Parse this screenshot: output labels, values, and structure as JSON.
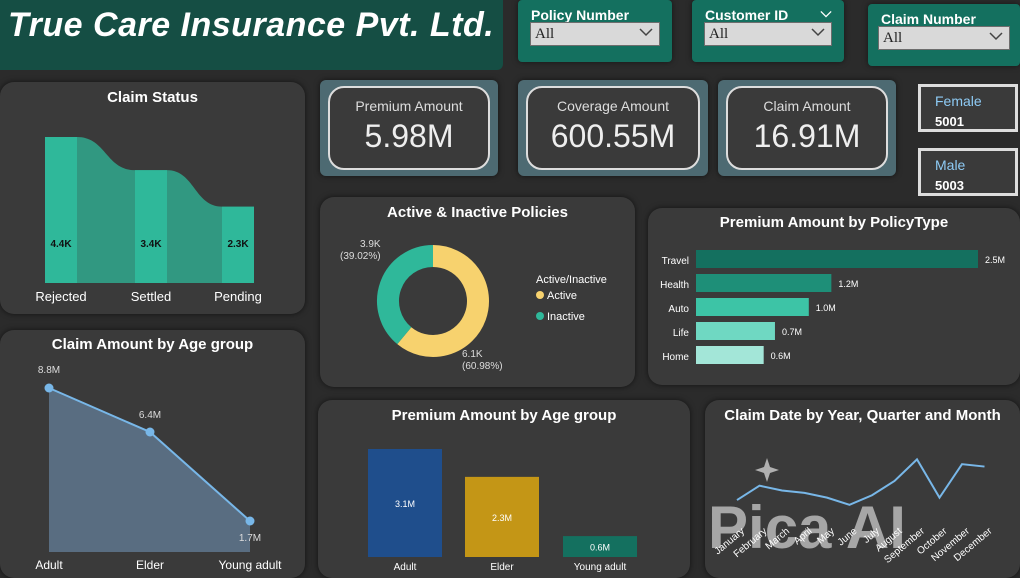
{
  "header": {
    "title": "True Care Insurance Pvt. Ltd."
  },
  "slicers": [
    {
      "label": "Policy Number",
      "value": "All"
    },
    {
      "label": "Customer ID",
      "value": "All"
    },
    {
      "label": "Claim Number",
      "value": "All"
    }
  ],
  "kpis": [
    {
      "label": "Premium Amount",
      "value": "5.98M"
    },
    {
      "label": "Coverage Amount",
      "value": "600.55M"
    },
    {
      "label": "Claim Amount",
      "value": "16.91M"
    }
  ],
  "gender": [
    {
      "label": "Female",
      "value": "5001"
    },
    {
      "label": "Male",
      "value": "5003"
    }
  ],
  "watermark": "Pica AI",
  "colors": {
    "teal": "#2fb89a",
    "dark_teal": "#14705f",
    "yellow": "#f7d26e",
    "blue_line": "#78b7e8",
    "bar_blue": "#1f4e8c",
    "bar_gold": "#c49616"
  },
  "chart_data": [
    {
      "type": "area",
      "title": "Claim Status",
      "categories": [
        "Rejected",
        "Settled",
        "Pending"
      ],
      "values": [
        4400,
        3400,
        2300
      ],
      "data_labels": [
        "4.4K",
        "3.4K",
        "2.3K"
      ]
    },
    {
      "type": "pie",
      "title": "Active & Inactive Policies",
      "legend_title": "Active/Inactive",
      "legend_position": "right",
      "categories": [
        "Active",
        "Inactive"
      ],
      "values": [
        6100,
        3900
      ],
      "data_labels": [
        "6.1K\n(60.98%)",
        "3.9K\n(39.02%)"
      ],
      "percent_labels": [
        "(60.98%)",
        "(39.02%)"
      ],
      "value_labels": [
        "6.1K",
        "3.9K"
      ]
    },
    {
      "type": "bar",
      "orientation": "horizontal",
      "title": "Premium Amount by PolicyType",
      "categories": [
        "Travel",
        "Health",
        "Auto",
        "Life",
        "Home"
      ],
      "values": [
        2.5,
        1.2,
        1.0,
        0.7,
        0.6
      ],
      "data_labels": [
        "2.5M",
        "1.2M",
        "1.0M",
        "0.7M",
        "0.6M"
      ]
    },
    {
      "type": "area",
      "title": "Claim Amount by Age group",
      "categories": [
        "Adult",
        "Elder",
        "Young adult"
      ],
      "values": [
        8.8,
        6.4,
        1.7
      ],
      "data_labels": [
        "8.8M",
        "6.4M",
        "1.7M"
      ]
    },
    {
      "type": "bar",
      "title": "Premium Amount by Age group",
      "categories": [
        "Adult",
        "Elder",
        "Young adult"
      ],
      "values": [
        3.1,
        2.3,
        0.6
      ],
      "data_labels": [
        "3.1M",
        "2.3M",
        "0.6M"
      ]
    },
    {
      "type": "line",
      "title": "Claim Date by Year, Quarter and Month",
      "categories": [
        "January",
        "February",
        "March",
        "April",
        "May",
        "June",
        "July",
        "August",
        "September",
        "October",
        "November",
        "December"
      ],
      "values": [
        1.3,
        1.36,
        1.34,
        1.33,
        1.31,
        1.28,
        1.32,
        1.38,
        1.47,
        1.31,
        1.45,
        1.44
      ]
    }
  ]
}
